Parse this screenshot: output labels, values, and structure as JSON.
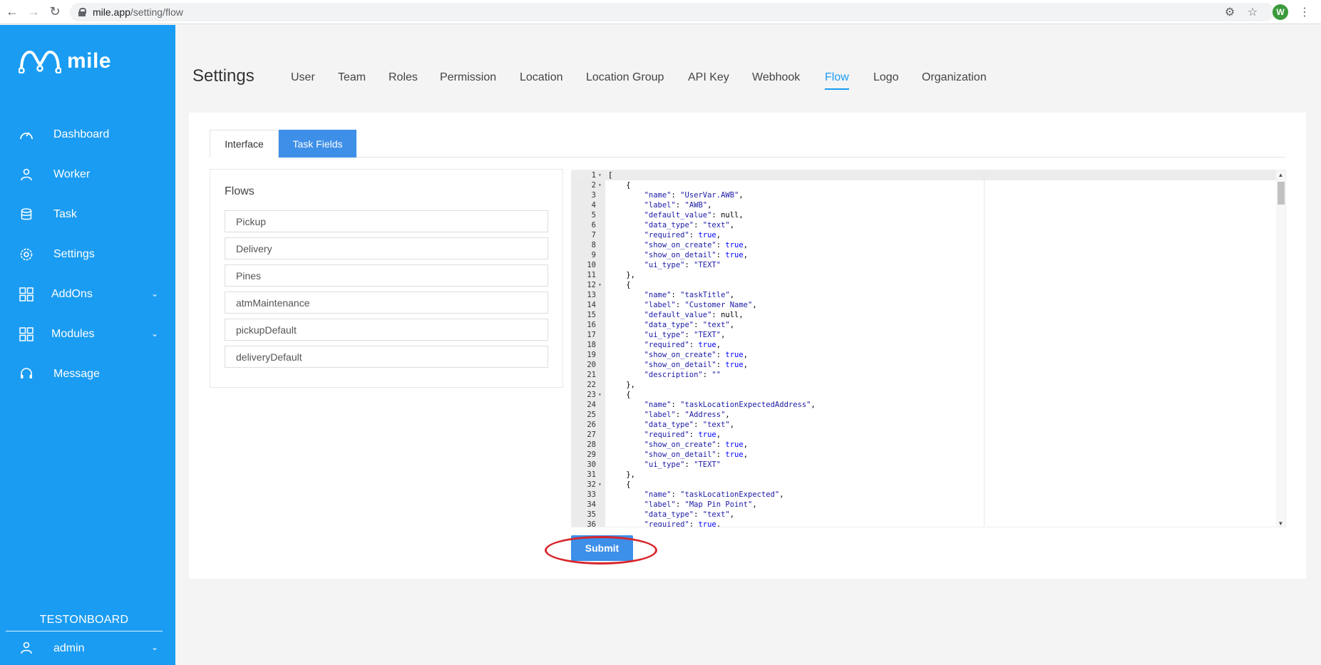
{
  "browser": {
    "url_host": "mile.app",
    "url_path": "/setting/flow",
    "profile_initial": "W"
  },
  "sidebar": {
    "brand": "mile",
    "items": [
      {
        "label": "Dashboard",
        "icon": "speedometer-icon",
        "has_chevron": false
      },
      {
        "label": "Worker",
        "icon": "user-icon",
        "has_chevron": false
      },
      {
        "label": "Task",
        "icon": "database-icon",
        "has_chevron": false
      },
      {
        "label": "Settings",
        "icon": "gear-icon",
        "has_chevron": false
      },
      {
        "label": "AddOns",
        "icon": "grid-icon",
        "has_chevron": true
      },
      {
        "label": "Modules",
        "icon": "grid-icon",
        "has_chevron": true
      },
      {
        "label": "Message",
        "icon": "headset-icon",
        "has_chevron": false
      }
    ],
    "org_name": "TESTONBOARD",
    "user": "admin"
  },
  "header": {
    "title": "Settings",
    "tabs": [
      "User",
      "Team",
      "Roles",
      "Permission",
      "Location",
      "Location Group",
      "API Key",
      "Webhook",
      "Flow",
      "Logo",
      "Organization"
    ],
    "active_tab": "Flow"
  },
  "subtabs": {
    "interface": "Interface",
    "task_fields": "Task Fields",
    "active": "Task Fields"
  },
  "flows": {
    "title": "Flows",
    "items": [
      "Pickup",
      "Delivery",
      "Pines",
      "atmMaintenance",
      "pickupDefault",
      "deliveryDefault"
    ]
  },
  "editor": {
    "lines": [
      "[",
      "    {",
      "        \"name\": \"UserVar.AWB\",",
      "        \"label\": \"AWB\",",
      "        \"default_value\": null,",
      "        \"data_type\": \"text\",",
      "        \"required\": true,",
      "        \"show_on_create\": true,",
      "        \"show_on_detail\": true,",
      "        \"ui_type\": \"TEXT\"",
      "    },",
      "    {",
      "        \"name\": \"taskTitle\",",
      "        \"label\": \"Customer Name\",",
      "        \"default_value\": null,",
      "        \"data_type\": \"text\",",
      "        \"ui_type\": \"TEXT\",",
      "        \"required\": true,",
      "        \"show_on_create\": true,",
      "        \"show_on_detail\": true,",
      "        \"description\": \"\"",
      "    },",
      "    {",
      "        \"name\": \"taskLocationExpectedAddress\",",
      "        \"label\": \"Address\",",
      "        \"data_type\": \"text\",",
      "        \"required\": true,",
      "        \"show_on_create\": true,",
      "        \"show_on_detail\": true,",
      "        \"ui_type\": \"TEXT\"",
      "    },",
      "    {",
      "        \"name\": \"taskLocationExpected\",",
      "        \"label\": \"Map Pin Point\",",
      "        \"data_type\": \"text\",",
      "        \"required\": true,"
    ],
    "fold_lines": [
      1,
      2,
      12,
      23,
      32
    ]
  },
  "submit_label": "Submit",
  "colors": {
    "sidebar": "#1a9cf2",
    "accent": "#3d8fe8",
    "highlight": "#d7262b"
  }
}
